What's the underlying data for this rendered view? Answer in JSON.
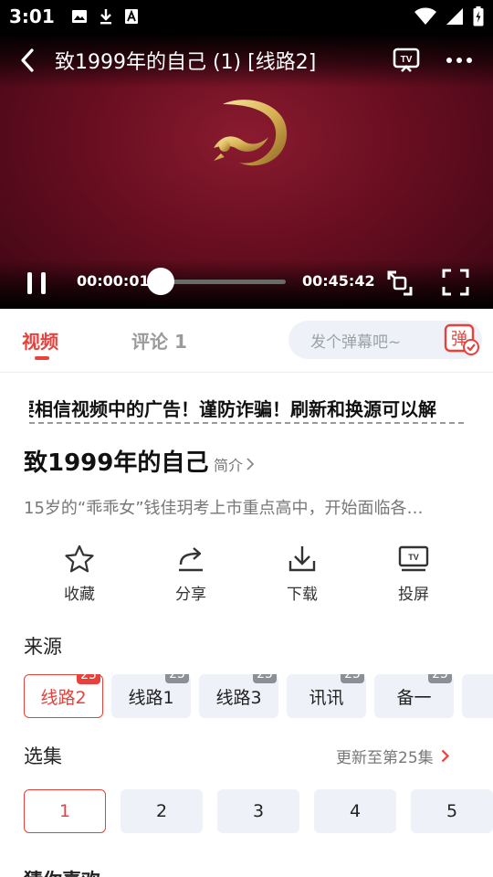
{
  "status_bar": {
    "time": "3:01"
  },
  "player": {
    "title": "致1999年的自己 (1) [线路2]",
    "current_time": "00:00:01",
    "total_time": "00:45:42",
    "progress": 0.0004
  },
  "tabs": {
    "video": "视频",
    "comments": "评论 1",
    "danmaku_placeholder": "发个弹幕吧~",
    "danmaku_button": "弹"
  },
  "notice": "要相信视频中的广告！谨防诈骗！刷新和换源可以解",
  "show": {
    "title": "致1999年的自己",
    "synopsis_label": "简介",
    "description": "15岁的“乖乖女”钱佳玥考上市重点高中，开始面临各…"
  },
  "actions": [
    {
      "label": "收藏",
      "icon": "star-icon"
    },
    {
      "label": "分享",
      "icon": "share-icon"
    },
    {
      "label": "下载",
      "icon": "download-icon"
    },
    {
      "label": "投屏",
      "icon": "cast-tv-icon"
    }
  ],
  "source": {
    "title": "来源",
    "items": [
      {
        "label": "线路2",
        "badge": "25",
        "active": true
      },
      {
        "label": "线路1",
        "badge": "25",
        "active": false
      },
      {
        "label": "线路3",
        "badge": "25",
        "active": false
      },
      {
        "label": "讯讯",
        "badge": "25",
        "active": false
      },
      {
        "label": "备一",
        "badge": "25",
        "active": false
      }
    ]
  },
  "episodes": {
    "title": "选集",
    "update_text": "更新至第25集",
    "items": [
      "1",
      "2",
      "3",
      "4",
      "5"
    ],
    "active_index": 0
  },
  "next_section": {
    "title": "猜你喜欢"
  },
  "colors": {
    "accent": "#e8413c",
    "chip_bg": "#eef1f7",
    "video_bg": "#6c0f22"
  }
}
